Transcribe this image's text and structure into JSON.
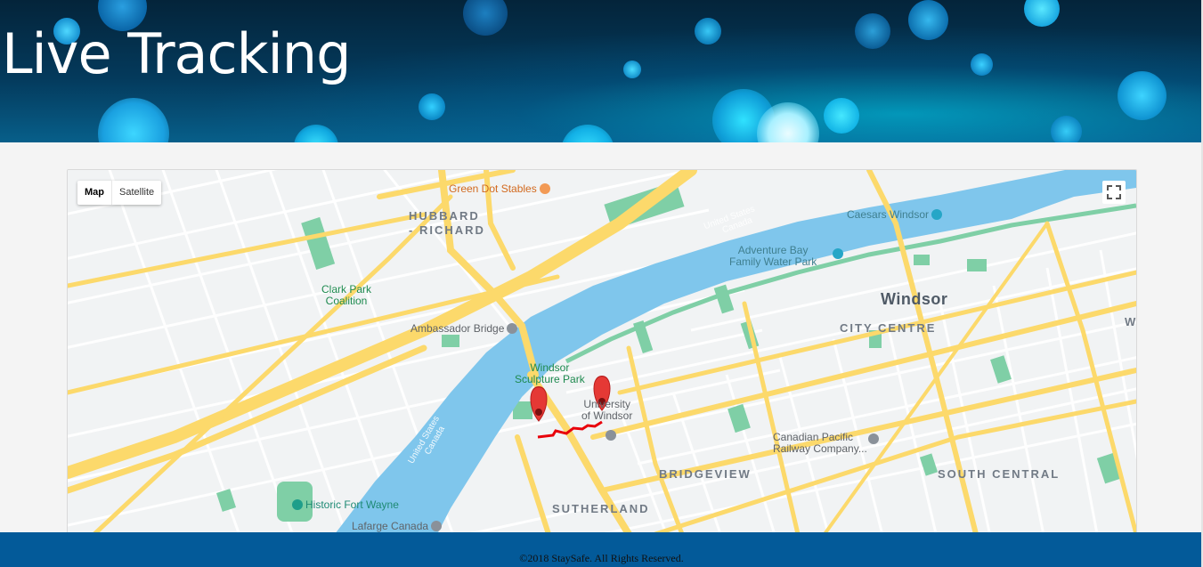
{
  "header": {
    "title": "Live Tracking"
  },
  "map": {
    "type_controls": {
      "map_label": "Map",
      "satellite_label": "Satellite",
      "selected": "Map"
    },
    "fullscreen_icon": "fullscreen-icon",
    "labels": {
      "green_dot_stables": "Green Dot Stables",
      "hubbard_1": "HUBBARD",
      "hubbard_2": "- RICHARD",
      "clark_park_1": "Clark Park",
      "clark_park_2": "Coalition",
      "ambassador_bridge": "Ambassador Bridge",
      "windsor_sculpture_1": "Windsor",
      "windsor_sculpture_2": "Sculpture Park",
      "university_1": "University",
      "university_2": "of Windsor",
      "caesars_windsor": "Caesars Windsor",
      "adventure_bay_1": "Adventure Bay",
      "adventure_bay_2": "Family Water Park",
      "windsor": "Windsor",
      "city_centre": "CITY CENTRE",
      "canadian_pacific_1": "Canadian Pacific",
      "canadian_pacific_2": "Railway Company...",
      "bridgeview": "BRIDGEVIEW",
      "south_central": "SOUTH CENTRAL",
      "sutherland": "SUTHERLAND",
      "historic_fort_wayne": "Historic Fort Wayne",
      "lafarge_canada": "Lafarge Canada",
      "us_canada_1": "United States",
      "us_canada_2": "Canada",
      "us_canada_3": "United States",
      "us_canada_4": "Canada",
      "edge_w": "W"
    },
    "markers": [
      "start-marker",
      "end-marker"
    ],
    "colors": {
      "water": "#7fc6ec",
      "road": "#fcd96b",
      "park": "#7fcfa6",
      "route": "#e8000a",
      "marker": "#e53935"
    }
  },
  "footer": {
    "copyright": "©2018 StaySafe. All Rights Reserved."
  }
}
